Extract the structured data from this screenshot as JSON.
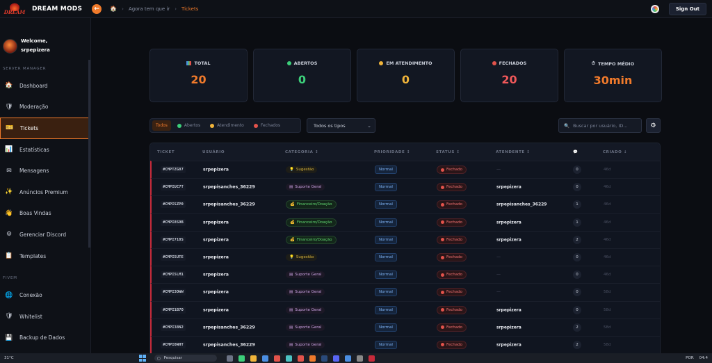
{
  "app": {
    "brand": "DREAM MODS",
    "logo_text": "DREAM"
  },
  "breadcrumb": {
    "home_icon": "home-icon",
    "items": [
      "Agora tem que ir",
      "Tickets"
    ]
  },
  "topbar": {
    "signout_label": "Sign Out"
  },
  "sidebar": {
    "welcome_line": "Welcome,",
    "username": "srpepizera",
    "section_server": "SERVER MANAGER",
    "section_fivem": "FIVEM",
    "items": [
      {
        "label": "Dashboard",
        "icon": "🏠"
      },
      {
        "label": "Moderação",
        "icon": "🛡"
      },
      {
        "label": "Tickets",
        "icon": "🎫"
      },
      {
        "label": "Estatísticas",
        "icon": "📊"
      },
      {
        "label": "Mensagens",
        "icon": "✉"
      },
      {
        "label": "Anúncios Premium",
        "icon": "✨"
      },
      {
        "label": "Boas Vindas",
        "icon": "👋"
      },
      {
        "label": "Gerenciar Discord",
        "icon": "⚙"
      },
      {
        "label": "Templates",
        "icon": "📋"
      }
    ],
    "fivem_items": [
      {
        "label": "Conexão",
        "icon": "🌐"
      },
      {
        "label": "Whitelist",
        "icon": "🛡"
      },
      {
        "label": "Backup de Dados",
        "icon": "💾"
      }
    ]
  },
  "stats": [
    {
      "label": "TOTAL",
      "value": "20",
      "color": "#f07a2b"
    },
    {
      "label": "ABERTOS",
      "value": "0",
      "color": "#3ccf7a"
    },
    {
      "label": "EM ATENDIMENTO",
      "value": "0",
      "color": "#f0b43a"
    },
    {
      "label": "FECHADOS",
      "value": "20",
      "color": "#f0585a"
    },
    {
      "label": "TEMPO MÉDIO",
      "value": "30min",
      "color": "#f07a2b"
    }
  ],
  "filters": {
    "tabs": [
      "Todos",
      "Abertos",
      "Atendimento",
      "Fechados"
    ],
    "type_select": "Todos os tipos",
    "search_placeholder": "Buscar por usuário, ID..."
  },
  "table": {
    "headers": [
      "TICKET",
      "USUÁRIO",
      "CATEGORIA ↕",
      "PRIORIDADE ↕",
      "STATUS ↕",
      "ATENDENTE ↕",
      "💬",
      "CRIADO ↓"
    ],
    "rows": [
      {
        "ticket": "#CMPTZG07",
        "user": "srpepizera",
        "category": "Sugestão",
        "cat": "sugestao",
        "priority": "Normal",
        "status": "Fechado",
        "agent": "—",
        "count": "0",
        "date": "46d"
      },
      {
        "ticket": "#CMPIUC7T",
        "user": "srpepisanches_36229",
        "category": "Suporte Geral",
        "cat": "suporte",
        "priority": "Normal",
        "status": "Fechado",
        "agent": "srpepizera",
        "count": "0",
        "date": "46d"
      },
      {
        "ticket": "#CMPISZP0",
        "user": "srpepisanches_36229",
        "category": "Financeiro/Doação",
        "cat": "financeiro",
        "priority": "Normal",
        "status": "Fechado",
        "agent": "srpepisanches_36229",
        "count": "1",
        "date": "46d"
      },
      {
        "ticket": "#CMPI8S9B",
        "user": "srpepizera",
        "category": "Financeiro/Doação",
        "cat": "financeiro",
        "priority": "Normal",
        "status": "Fechado",
        "agent": "srpepizera",
        "count": "1",
        "date": "46d"
      },
      {
        "ticket": "#CMPI710S",
        "user": "srpepizera",
        "category": "Financeiro/Doação",
        "cat": "financeiro",
        "priority": "Normal",
        "status": "Fechado",
        "agent": "srpepizera",
        "count": "2",
        "date": "46d"
      },
      {
        "ticket": "#CMPI5UTE",
        "user": "srpepizera",
        "category": "Sugestão",
        "cat": "sugestao",
        "priority": "Normal",
        "status": "Fechado",
        "agent": "—",
        "count": "0",
        "date": "46d"
      },
      {
        "ticket": "#CMPI5LM1",
        "user": "srpepizera",
        "category": "Suporte Geral",
        "cat": "suporte",
        "priority": "Normal",
        "status": "Fechado",
        "agent": "—",
        "count": "0",
        "date": "46d"
      },
      {
        "ticket": "#CMPI3OWW",
        "user": "srpepizera",
        "category": "Suporte Geral",
        "cat": "suporte",
        "priority": "Normal",
        "status": "Fechado",
        "agent": "—",
        "count": "0",
        "date": "58d"
      },
      {
        "ticket": "#CMPI1B7O",
        "user": "srpepizera",
        "category": "Suporte Geral",
        "cat": "suporte",
        "priority": "Normal",
        "status": "Fechado",
        "agent": "srpepizera",
        "count": "0",
        "date": "58d"
      },
      {
        "ticket": "#CMPI38N2",
        "user": "srpepisanches_36229",
        "category": "Suporte Geral",
        "cat": "suporte",
        "priority": "Normal",
        "status": "Fechado",
        "agent": "srpepizera",
        "count": "2",
        "date": "58d"
      },
      {
        "ticket": "#CMPI0WHT",
        "user": "srpepisanches_36229",
        "category": "Suporte Geral",
        "cat": "suporte",
        "priority": "Normal",
        "status": "Fechado",
        "agent": "srpepizera",
        "count": "2",
        "date": "58d"
      }
    ]
  },
  "taskbar": {
    "weather": "31°C",
    "search": "Pesquisar",
    "lang": "POR",
    "clock": "04:4"
  }
}
